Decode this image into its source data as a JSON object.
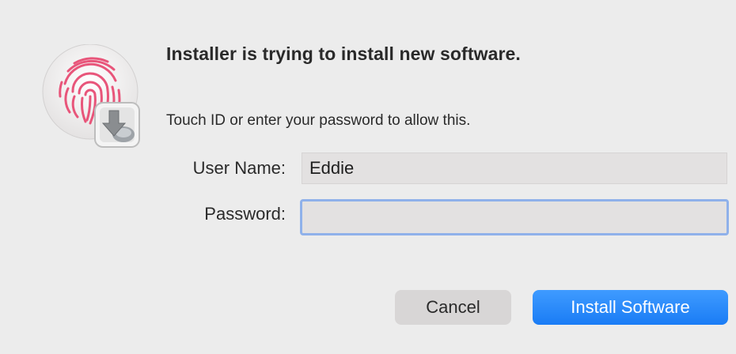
{
  "dialog": {
    "title": "Installer is trying to install new software.",
    "message": "Touch ID or enter your password to allow this.",
    "username_label": "User Name:",
    "username_value": "Eddie",
    "password_label": "Password:",
    "password_value": "",
    "cancel_label": "Cancel",
    "install_label": "Install Software"
  },
  "icons": {
    "main": "touch-id-fingerprint-icon",
    "badge": "installer-icon"
  },
  "colors": {
    "background": "#ececec",
    "fingerprint": "#e8557a",
    "primary_button": "#1a7cf5",
    "focus_ring": "#8fb1ea",
    "field_background": "#e3e1e1"
  }
}
